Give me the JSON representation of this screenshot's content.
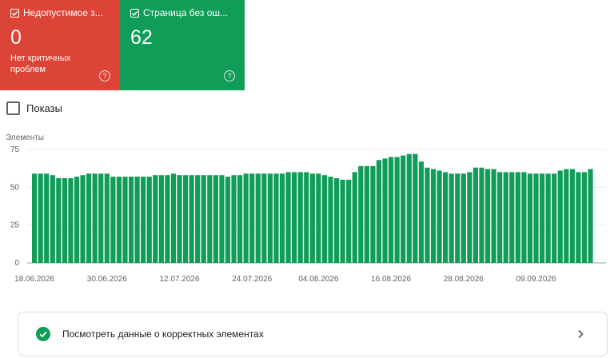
{
  "cards": [
    {
      "title": "Недопустимое з...",
      "value": "0",
      "subtitle": "Нет критичных проблем",
      "color": "#db4437"
    },
    {
      "title": "Страница без ош...",
      "value": "62",
      "subtitle": "",
      "color": "#0f9d58"
    }
  ],
  "toggle": {
    "label": "Показы",
    "checked": false
  },
  "detail_row": {
    "label": "Посмотреть данные о корректных элементах",
    "status_icon": "check-circle-icon",
    "arrow_icon": "chevron-right-icon"
  },
  "chart_data": {
    "type": "bar",
    "ylabel": "Элементы",
    "ylim": [
      0,
      75
    ],
    "yticks": [
      "0",
      "25",
      "50",
      "75"
    ],
    "grid": true,
    "bar_color": "#0f9d58",
    "x_tick_labels": [
      "18.06.2026",
      "30.06.2026",
      "12.07.2026",
      "24.07.2026",
      "04.08.2026",
      "16.08.2026",
      "28.08.2026",
      "09.09.2026"
    ],
    "categories": [
      "18.06",
      "19.06",
      "20.06",
      "21.06",
      "22.06",
      "23.06",
      "24.06",
      "25.06",
      "26.06",
      "27.06",
      "28.06",
      "29.06",
      "30.06",
      "01.07",
      "02.07",
      "03.07",
      "04.07",
      "05.07",
      "06.07",
      "07.07",
      "08.07",
      "09.07",
      "10.07",
      "11.07",
      "12.07",
      "13.07",
      "14.07",
      "15.07",
      "16.07",
      "17.07",
      "18.07",
      "19.07",
      "20.07",
      "21.07",
      "22.07",
      "23.07",
      "24.07",
      "25.07",
      "26.07",
      "27.07",
      "28.07",
      "29.07",
      "30.07",
      "31.07",
      "01.08",
      "02.08",
      "03.08",
      "04.08",
      "05.08",
      "06.08",
      "07.08",
      "08.08",
      "09.08",
      "10.08",
      "11.08",
      "12.08",
      "13.08",
      "14.08",
      "15.08",
      "16.08",
      "17.08",
      "18.08",
      "19.08",
      "20.08",
      "21.08",
      "22.08",
      "23.08",
      "24.08",
      "25.08",
      "26.08",
      "27.08",
      "28.08",
      "29.08",
      "30.08",
      "31.08",
      "01.09",
      "02.09",
      "03.09",
      "04.09",
      "05.09",
      "06.09",
      "07.09",
      "08.09",
      "09.09",
      "10.09",
      "11.09",
      "12.09",
      "13.09",
      "14.09",
      "15.09",
      "16.09"
    ],
    "values": [
      59,
      59,
      59,
      58,
      56,
      56,
      56,
      57,
      58,
      59,
      59,
      59,
      59,
      57,
      57,
      57,
      57,
      57,
      57,
      57,
      58,
      58,
      58,
      59,
      58,
      58,
      58,
      58,
      58,
      58,
      58,
      58,
      57,
      58,
      58,
      59,
      59,
      59,
      59,
      59,
      59,
      59,
      60,
      60,
      60,
      60,
      59,
      59,
      58,
      57,
      56,
      55,
      55,
      60,
      64,
      64,
      64,
      68,
      69,
      70,
      70,
      71,
      72,
      72,
      67,
      63,
      62,
      61,
      60,
      59,
      59,
      59,
      60,
      63,
      63,
      62,
      62,
      60,
      60,
      60,
      60,
      60,
      59,
      59,
      59,
      59,
      59,
      61,
      62,
      62,
      60,
      60,
      62
    ]
  }
}
